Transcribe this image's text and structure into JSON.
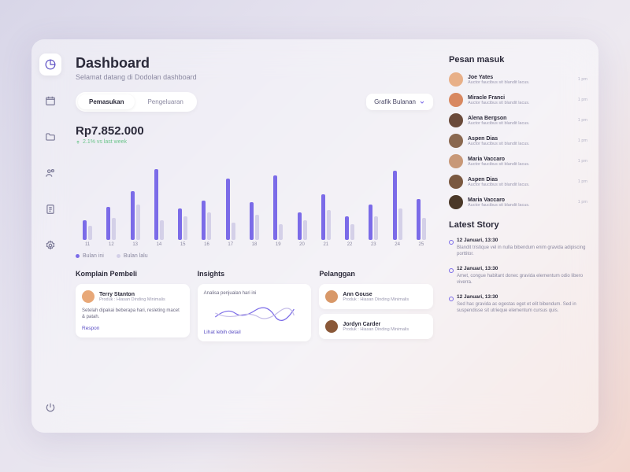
{
  "header": {
    "title": "Dashboard",
    "subtitle": "Selamat datang di Dodolan dashboard"
  },
  "tabs": {
    "income": "Pemasukan",
    "expense": "Pengeluaran"
  },
  "dropdown": {
    "label": "Grafik Bulanan"
  },
  "amount": {
    "value": "Rp7.852.000",
    "change": "2.1% vs last week"
  },
  "legend": {
    "a": "Bulan ini",
    "b": "Bulan lalu"
  },
  "chart_data": {
    "type": "bar",
    "categories": [
      "11",
      "12",
      "13",
      "14",
      "15",
      "16",
      "17",
      "18",
      "19",
      "20",
      "21",
      "22",
      "23",
      "24",
      "25"
    ],
    "series": [
      {
        "name": "Bulan ini",
        "values": [
          25,
          42,
          62,
          90,
          40,
          50,
          78,
          48,
          82,
          35,
          58,
          30,
          45,
          88,
          52
        ]
      },
      {
        "name": "Bulan lalu",
        "values": [
          18,
          28,
          45,
          25,
          30,
          35,
          22,
          32,
          20,
          25,
          38,
          20,
          30,
          40,
          28
        ]
      }
    ],
    "ylim": [
      0,
      100
    ]
  },
  "cards": {
    "komplain": {
      "title": "Komplain Pembeli",
      "user": "Terry Stanton",
      "user_sub": "Produk : Hiasan Dinding Minimalis",
      "text": "Setelah dipakai beberapa hari, resleting macet & patah.",
      "action": "Respon"
    },
    "insights": {
      "title": "Insights",
      "text": "Analisa penjualan hari ini",
      "action": "Lihat lebih detail"
    },
    "pelanggan": {
      "title": "Pelanggan",
      "items": [
        {
          "name": "Ann Gouse",
          "sub": "Produk : Hiasan Dinding Minimalis"
        },
        {
          "name": "Jordyn Carder",
          "sub": "Produk : Hiasan Dinding Minimalis"
        }
      ]
    }
  },
  "inbox": {
    "title": "Pesan masuk",
    "items": [
      {
        "name": "Joe Yates",
        "sub": "Auctor faucibus sit blandit lacus.",
        "time": "1 pm",
        "color": "#e8b088"
      },
      {
        "name": "Miracle Franci",
        "sub": "Auctor faucibus sit blandit lacus.",
        "time": "1 pm",
        "color": "#d88860"
      },
      {
        "name": "Alena Bergson",
        "sub": "Auctor faucibus sit blandit lacus.",
        "time": "1 pm",
        "color": "#6a4a3a"
      },
      {
        "name": "Aspen Dias",
        "sub": "Auctor faucibus sit blandit lacus.",
        "time": "1 pm",
        "color": "#8a6850"
      },
      {
        "name": "Maria Vaccaro",
        "sub": "Auctor faucibus sit blandit lacus.",
        "time": "1 pm",
        "color": "#c89878"
      },
      {
        "name": "Aspen Dias",
        "sub": "Auctor faucibus sit blandit lacus.",
        "time": "1 pm",
        "color": "#7a5840"
      },
      {
        "name": "Maria Vaccaro",
        "sub": "Auctor faucibus sit blandit lacus.",
        "time": "1 pm",
        "color": "#4a3828"
      }
    ]
  },
  "stories": {
    "title": "Latest Story",
    "items": [
      {
        "date": "12 Januari, 13:30",
        "text": "Blandit tristique vel in nulla bibendum enim gravida adipiscing porttitor."
      },
      {
        "date": "12 Januari, 13:30",
        "text": "Amet, congue habitant donec gravida elementum odio libero viverra."
      },
      {
        "date": "12 Januari, 13:30",
        "text": "Sed hac gravida ac egestas eget et elit bibendum. Sed in suspendisse sit utrieque elementum cursus quis."
      }
    ]
  }
}
